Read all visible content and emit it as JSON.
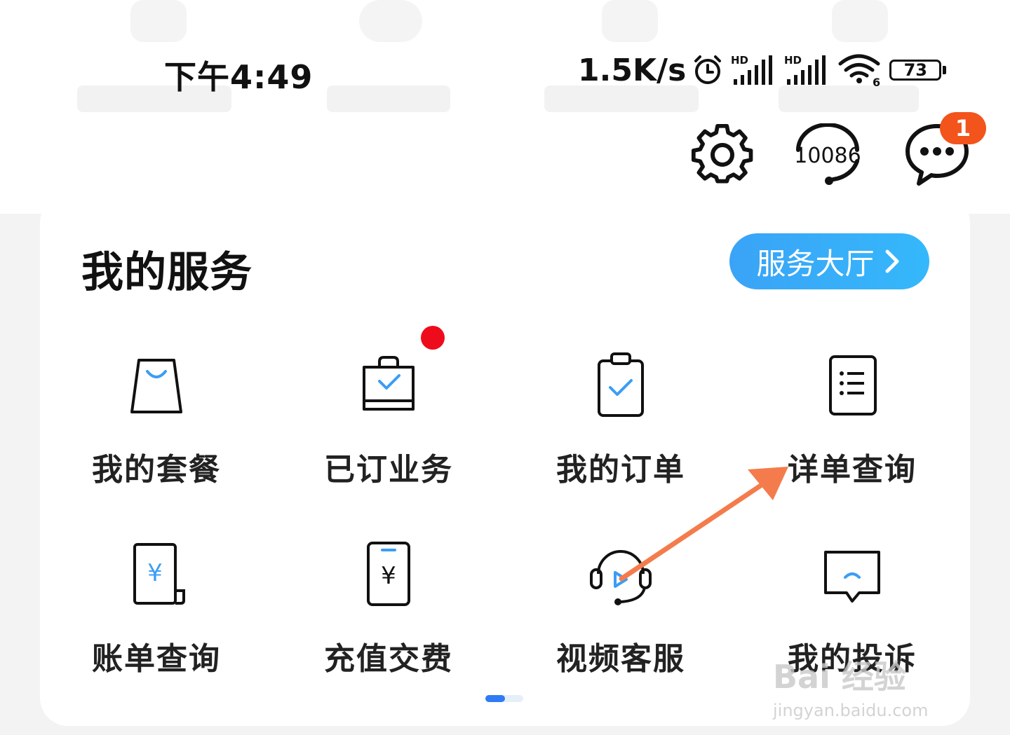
{
  "status_bar": {
    "time": "下午4:49",
    "net_speed": "1.5K/s",
    "hd1": "HD",
    "hd2": "HD",
    "wifi_gen": "6",
    "battery": "73"
  },
  "header": {
    "hotline": "10086",
    "message_badge": "1"
  },
  "services": {
    "title": "我的服务",
    "hall_button": "服务大厅",
    "items": [
      {
        "label": "我的套餐",
        "icon": "shopping-bag-icon"
      },
      {
        "label": "已订业务",
        "icon": "subscribed-bag-icon"
      },
      {
        "label": "我的订单",
        "icon": "clipboard-check-icon"
      },
      {
        "label": "详单查询",
        "icon": "detail-list-icon"
      },
      {
        "label": "账单查询",
        "icon": "bill-yuan-icon"
      },
      {
        "label": "充值交费",
        "icon": "phone-yuan-icon"
      },
      {
        "label": "视频客服",
        "icon": "headset-video-icon"
      },
      {
        "label": "我的投诉",
        "icon": "complaint-chat-icon"
      }
    ]
  },
  "watermark": {
    "logo": "Bai 经验",
    "url": "jingyan.baidu.com"
  },
  "colors": {
    "accent_blue": "#3aa3f6",
    "badge_orange": "#f2541b",
    "dot_red": "#ee0c1c",
    "arrow_orange": "#f47c4c"
  }
}
